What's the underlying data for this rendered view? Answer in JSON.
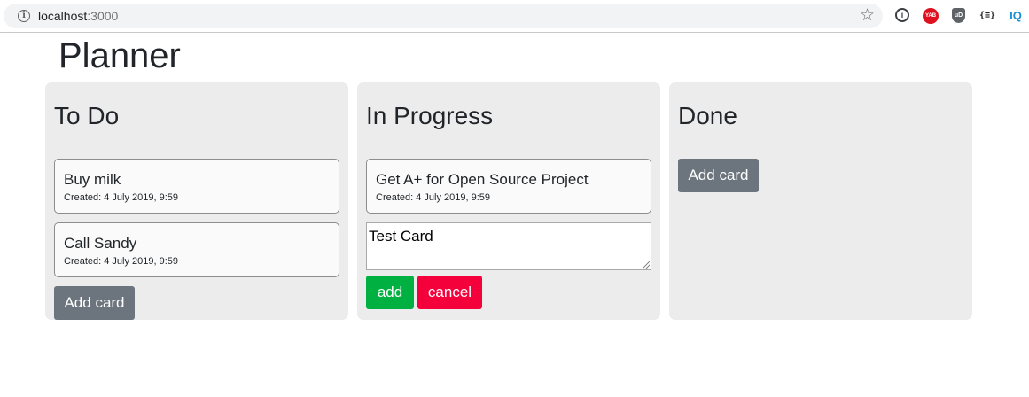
{
  "browser": {
    "url_host": "localhost",
    "url_port": ":3000",
    "info_icon": "i",
    "star_icon": "☆",
    "extensions": [
      "i",
      "YAB",
      "uD",
      "{≡}",
      "IQ"
    ]
  },
  "page": {
    "title": "Planner"
  },
  "columns": [
    {
      "title": "To Do",
      "cards": [
        {
          "title": "Buy milk",
          "created": "Created: 4 July 2019, 9:59"
        },
        {
          "title": "Call Sandy",
          "created": "Created: 4 July 2019, 9:59"
        }
      ],
      "add_card_label": "Add card"
    },
    {
      "title": "In Progress",
      "cards": [
        {
          "title": "Get A+ for Open Source Project",
          "created": "Created: 4 July 2019, 9:59"
        }
      ],
      "new_card": {
        "value": "Test Card",
        "add_label": "add",
        "cancel_label": "cancel"
      }
    },
    {
      "title": "Done",
      "cards": [],
      "add_card_label": "Add card"
    }
  ],
  "colors": {
    "column_bg": "#ececec",
    "add_card_button": "#6c757d",
    "add_button": "#00b040",
    "cancel_button": "#f4003a"
  }
}
